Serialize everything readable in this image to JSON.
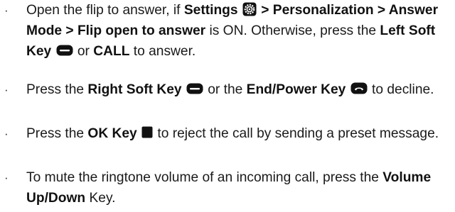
{
  "items": [
    {
      "s1": "Open the flip to answer, if ",
      "b1": "Settings",
      "s2": " ",
      "icon1": "settings-gear-icon",
      "b2": " > Personalization > Answer Mode > Flip open to answer",
      "s3": " is ON. Otherwise, press the ",
      "b3": "Left Soft Key",
      "icon2": "soft-key-icon",
      "s4": " or ",
      "b4": "CALL",
      "s5": " to answer."
    },
    {
      "s1": "Press the ",
      "b1": "Right Soft Key",
      "icon1": "soft-key-icon",
      "s2": " or the ",
      "b2": "End/Power Key",
      "icon2": "end-power-key-icon",
      "s3": " to decline."
    },
    {
      "s1": "Press the ",
      "b1": "OK Key",
      "icon1": "ok-key-icon",
      "s2": " to reject the call by sending a preset message."
    },
    {
      "s1": "To mute the ringtone volume of an incoming call, press the ",
      "b1": "Volume Up/Down",
      "s2": " Key."
    }
  ],
  "bullet": "·",
  "colors": {
    "text": "#1a1a1a",
    "icon": "#111111",
    "icon_bg": "#ffffff"
  }
}
